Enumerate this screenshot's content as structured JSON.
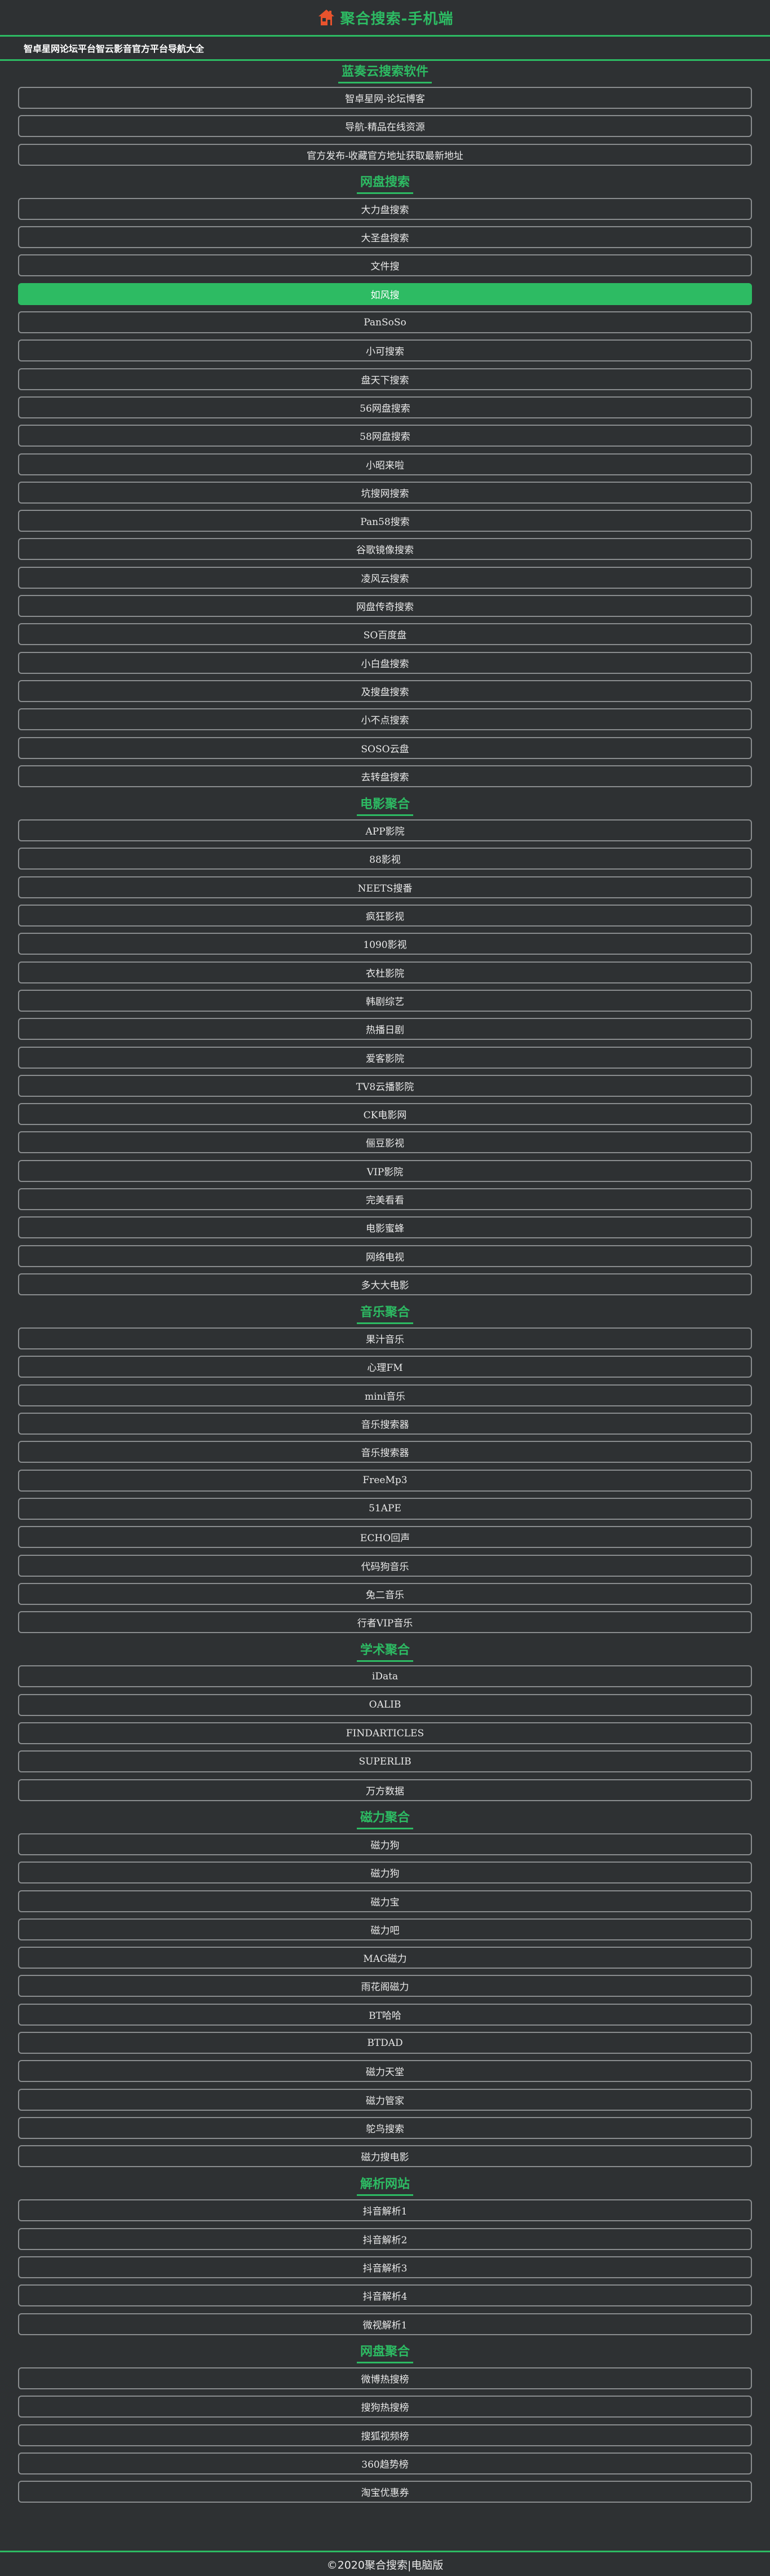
{
  "header": {
    "title": "聚合搜索-手机端",
    "logo_icon": "house-icon",
    "brand_color": "#2dbb63",
    "logo_color": "#e8532d"
  },
  "notice": "智卓星网论坛平台智云影音官方平台导航大全",
  "sections": [
    {
      "title": "蓝奏云搜索软件",
      "items": [
        "智卓星网-论坛博客",
        "导航-精品在线资源",
        "官方发布-收藏官方地址获取最新地址"
      ]
    },
    {
      "title": "网盘搜索",
      "items": [
        "大力盘搜索",
        "大圣盘搜索",
        "文件搜",
        "如风搜",
        "PanSoSo",
        "小可搜索",
        "盘天下搜索",
        "56网盘搜索",
        "58网盘搜索",
        "小昭来啦",
        "坑搜网搜索",
        "Pan58搜索",
        "谷歌镜像搜索",
        "凌风云搜索",
        "网盘传奇搜索",
        "SO百度盘",
        "小白盘搜索",
        "及搜盘搜索",
        "小不点搜索",
        "SOSO云盘",
        "去转盘搜索"
      ],
      "active": "如风搜"
    },
    {
      "title": "电影聚合",
      "items": [
        "APP影院",
        "88影视",
        "NEETS搜番",
        "疯狂影视",
        "1090影视",
        "衣杜影院",
        "韩剧综艺",
        "热播日剧",
        "爱客影院",
        "TV8云播影院",
        "CK电影网",
        "俪豆影视",
        "VIP影院",
        "完美看看",
        "电影蜜蜂",
        "网络电视",
        "多大大电影"
      ]
    },
    {
      "title": "音乐聚合",
      "items": [
        "果汁音乐",
        "心理FM",
        "mini音乐",
        "音乐搜索器",
        "音乐搜索器",
        "FreeMp3",
        "51APE",
        "ECHO回声",
        "代码狗音乐",
        "兔二音乐",
        "行者VIP音乐"
      ]
    },
    {
      "title": "学术聚合",
      "items": [
        "iData",
        "OALIB",
        "FINDARTICLES",
        "SUPERLIB",
        "万方数据"
      ]
    },
    {
      "title": "磁力聚合",
      "items": [
        "磁力狗",
        "磁力狗",
        "磁力宝",
        "磁力吧",
        "MAG磁力",
        "雨花阁磁力",
        "BT哈哈",
        "BTDAD",
        "磁力天堂",
        "磁力管家",
        "鸵鸟搜索",
        "磁力搜电影"
      ]
    },
    {
      "title": "解析网站",
      "items": [
        "抖音解析1",
        "抖音解析2",
        "抖音解析3",
        "抖音解析4",
        "微视解析1"
      ]
    },
    {
      "title": "网盘聚合",
      "items": [
        "微博热搜榜",
        "搜狗热搜榜",
        "搜狐视频榜",
        "360趋势榜",
        "淘宝优惠券"
      ]
    }
  ],
  "footer": "©2020聚合搜索|电脑版"
}
